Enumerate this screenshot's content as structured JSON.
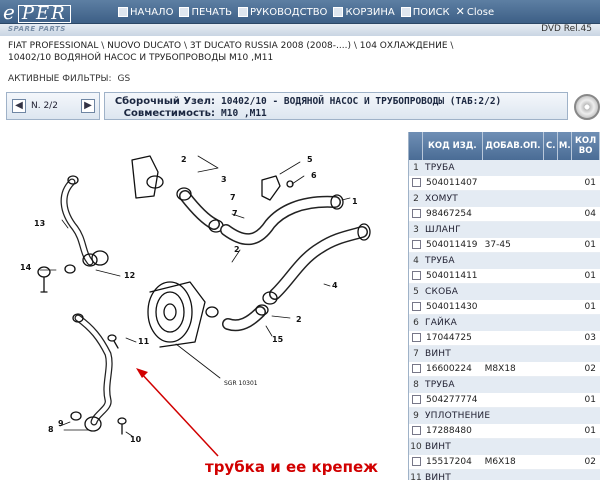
{
  "app": {
    "logo_prefix": "e",
    "logo_text": "PER",
    "spare_parts": "SPARE PARTS",
    "release": "DVD Rel.45"
  },
  "menu": [
    {
      "label": "НАЧАЛО",
      "icon": "home-icon"
    },
    {
      "label": "ПЕЧАТЬ",
      "icon": "print-icon"
    },
    {
      "label": "РУКОВОДСТВО",
      "icon": "manual-icon"
    },
    {
      "label": "КОРЗИНА",
      "icon": "cart-icon"
    },
    {
      "label": "ПОИСК",
      "icon": "search-icon"
    },
    {
      "label": "Close",
      "icon": "close-icon"
    }
  ],
  "breadcrumb": {
    "line1": "FIAT PROFESSIONAL \\ NUOVO DUCATO \\ 3T DUCATO RUSSIA 2008 (2008-....) \\ 104 ОХЛАЖДЕНИЕ \\",
    "line2": "10402/10 ВОДЯНОЙ НАСОС И ТРУБОПРОВОДЫ M10 ,M11"
  },
  "filters": {
    "label": "АКТИВНЫЕ ФИЛЬТРЫ:",
    "value": "GS"
  },
  "nav": {
    "page": "N. 2/2"
  },
  "group": {
    "label1": "Сборочный Узел:",
    "value1": "10402/10 - ВОДЯНОЙ НАСОС И ТРУБОПРОВОДЫ (ТАБ:2/2)",
    "label2": "Совместимость:",
    "value2": "M10 ,M11"
  },
  "diagram": {
    "labels": [
      "1",
      "2",
      "3",
      "4",
      "5",
      "6",
      "7",
      "2",
      "8",
      "9",
      "10",
      "11",
      "12",
      "13",
      "14",
      "15",
      "2",
      "7"
    ],
    "ref": "SGR 10301"
  },
  "callout": "трубка и ее крепеж",
  "table": {
    "headers": [
      "",
      "КОД ИЗД.",
      "ДОБАВ.ОП.",
      "С.",
      "М.",
      "КОЛ ВО"
    ],
    "rows": [
      {
        "n": "1",
        "name": "ТРУБА",
        "code": "504011407",
        "add": "",
        "qty": "01"
      },
      {
        "n": "2",
        "name": "ХОМУТ",
        "code": "98467254",
        "add": "",
        "qty": "04"
      },
      {
        "n": "3",
        "name": "ШЛАНГ",
        "code": "504011419",
        "add": "37-45",
        "qty": "01"
      },
      {
        "n": "4",
        "name": "ТРУБА",
        "code": "504011411",
        "add": "",
        "qty": "01"
      },
      {
        "n": "5",
        "name": "СКОБА",
        "code": "504011430",
        "add": "",
        "qty": "01"
      },
      {
        "n": "6",
        "name": "ГАЙКА",
        "code": "17044725",
        "add": "",
        "qty": "03"
      },
      {
        "n": "7",
        "name": "ВИНТ",
        "code": "16600224",
        "add": "M8X18",
        "qty": "02"
      },
      {
        "n": "8",
        "name": "ТРУБА",
        "code": "504277774",
        "add": "",
        "qty": "01"
      },
      {
        "n": "9",
        "name": "УПЛОТНЕНИЕ",
        "code": "17288480",
        "add": "",
        "qty": "01"
      },
      {
        "n": "10",
        "name": "ВИНТ",
        "code": "15517204",
        "add": "M6X18",
        "qty": "02"
      },
      {
        "n": "11",
        "name": "ВИНТ",
        "code": "",
        "add": "",
        "qty": ""
      }
    ]
  }
}
